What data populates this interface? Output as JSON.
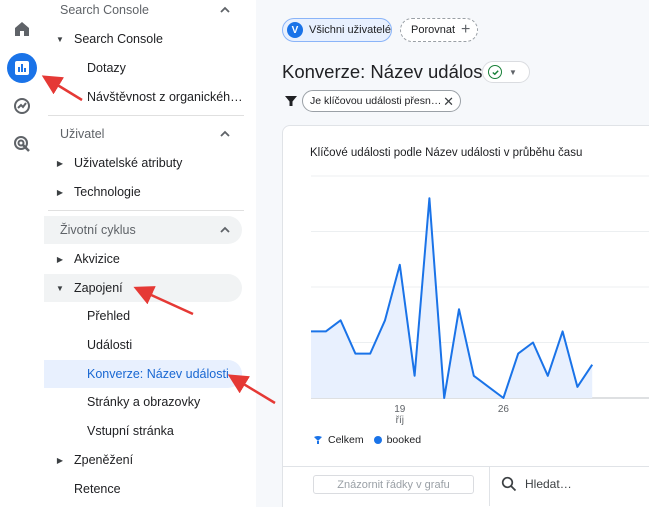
{
  "rail": {
    "icons": [
      "home-icon",
      "reports-icon",
      "explore-icon",
      "advertising-icon"
    ],
    "accent": "#1a73e8"
  },
  "sidebar": {
    "sections": [
      {
        "label": "Search Console"
      },
      {
        "label": "Uživatel"
      },
      {
        "label": "Životní cyklus"
      }
    ],
    "items": [
      {
        "label": "Search Console"
      },
      {
        "label": "Dotazy"
      },
      {
        "label": "Návštěvnost z organickéh…"
      },
      {
        "label": "Uživatelské atributy"
      },
      {
        "label": "Technologie"
      },
      {
        "label": "Akvizice"
      },
      {
        "label": "Zapojení"
      },
      {
        "label": "Přehled"
      },
      {
        "label": "Události"
      },
      {
        "label": "Konverze: Název události"
      },
      {
        "label": "Stránky a obrazovky"
      },
      {
        "label": "Vstupní stránka"
      },
      {
        "label": "Zpeněžení"
      },
      {
        "label": "Retence"
      }
    ]
  },
  "main": {
    "users_chip": "Všichni uživatelé",
    "users_avatar": "V",
    "compare_chip": "Porovnat",
    "title": "Konverze: Název události",
    "filter_chip": "Je klíčovou události přesn…",
    "card_title": "Klíčové události podle Název události v průběhu času",
    "legend": [
      "Celkem",
      "booked"
    ],
    "plot_rows_button": "Znázornit řádky v grafu",
    "search_placeholder": "Hledat…"
  },
  "chart_data": {
    "type": "area",
    "title": "Klíčové události podle Název události v průběhu času",
    "x_ticks": [
      {
        "label": "19",
        "sublabel": "říj",
        "index": 6
      },
      {
        "label": "26",
        "index": 13
      }
    ],
    "series": [
      {
        "name": "booked",
        "values": [
          3,
          3,
          3.5,
          2,
          2,
          3.5,
          6,
          1,
          9,
          0,
          4,
          1,
          0.5,
          0,
          2,
          2.5,
          1,
          3,
          0.5,
          1.5
        ]
      }
    ],
    "ylim": [
      0,
      10
    ],
    "grid": true,
    "colors": {
      "line": "#1a73e8",
      "fill": "#e8f0fe"
    }
  }
}
